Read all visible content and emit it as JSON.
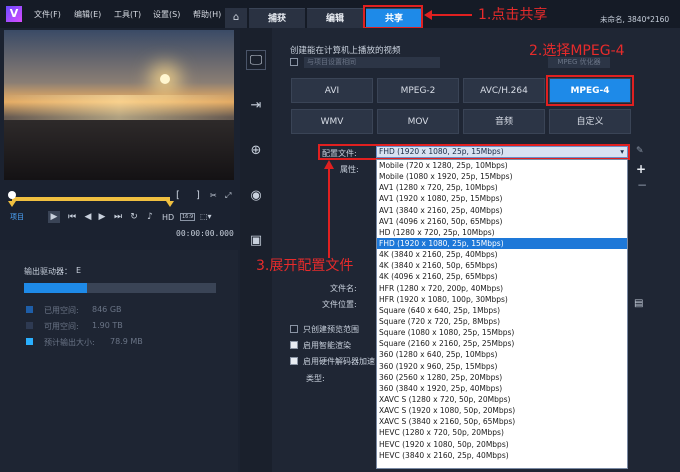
{
  "menu": {
    "file": "文件(F)",
    "edit": "编辑(E)",
    "tools": "工具(T)",
    "settings": "设置(S)",
    "help": "帮助(H)"
  },
  "tabs": {
    "capture": "捕获",
    "edit": "编辑",
    "share": "共享"
  },
  "project_info": "未命名, 3840*2160",
  "annotations": {
    "step1": "1.点击共享",
    "step2": "2.选择MPEG-4",
    "step3": "3.展开配置文件"
  },
  "player": {
    "project_label": "项目",
    "timecode": "00:00:00.000",
    "hd": "HD",
    "ratio": "16:9"
  },
  "output": {
    "drive_label": "输出驱动器：",
    "drive": "E",
    "used_label": "已用空间:",
    "used": "846 GB",
    "free_label": "可用空间:",
    "free": "1.90 TB",
    "estimated_label": "预计输出大小:",
    "estimated": "78.9 MB",
    "drive_fill_percent": 33
  },
  "share": {
    "heading": "创建能在计算机上播放的视频",
    "match_project": "与项目设置相同",
    "mpeg_optimizer": "MPEG 优化器",
    "formats": [
      "AVI",
      "MPEG-2",
      "AVC/H.264",
      "MPEG-4",
      "WMV",
      "MOV",
      "音频",
      "自定义"
    ],
    "selected_format": "MPEG-4",
    "profile_label": "配置文件:",
    "profile_value": "FHD (1920 x 1080, 25p, 15Mbps)",
    "properties_label": "属性:",
    "filename_label": "文件名:",
    "location_label": "文件位置:",
    "preview_only": "只创建预览范围",
    "smart_render": "启用智能渲染",
    "hw_encoder": "启用硬件解码器加速",
    "type_label": "类型:"
  },
  "profiles": [
    "Mobile (720 x 1280, 25p, 10Mbps)",
    "Mobile (1080 x 1920, 25p, 15Mbps)",
    "AV1 (1280 x 720, 25p, 10Mbps)",
    "AV1 (1920 x 1080, 25p, 15Mbps)",
    "AV1 (3840 x 2160, 25p, 40Mbps)",
    "AV1 (4096 x 2160, 50p, 65Mbps)",
    "HD (1280 x 720, 25p, 10Mbps)",
    "FHD (1920 x 1080, 25p, 15Mbps)",
    "4K (3840 x 2160, 25p, 40Mbps)",
    "4K (3840 x 2160, 50p, 65Mbps)",
    "4K (4096 x 2160, 25p, 65Mbps)",
    "HFR (1280 x 720, 200p, 40Mbps)",
    "HFR (1920 x 1080, 100p, 30Mbps)",
    "Square (640 x 640, 25p, 1Mbps)",
    "Square (720 x 720, 25p, 8Mbps)",
    "Square (1080 x 1080, 25p, 15Mbps)",
    "Square (2160 x 2160, 25p, 25Mbps)",
    "360 (1280 x 640, 25p, 10Mbps)",
    "360 (1920 x 960, 25p, 15Mbps)",
    "360 (2560 x 1280, 25p, 20Mbps)",
    "360 (3840 x 1920, 25p, 40Mbps)",
    "XAVC S (1280 x 720, 50p, 20Mbps)",
    "XAVC S (1920 x 1080, 50p, 20Mbps)",
    "XAVC S (3840 x 2160, 50p, 65Mbps)",
    "HEVC (1280 x 720, 50p, 20Mbps)",
    "HEVC (1920 x 1080, 50p, 20Mbps)",
    "HEVC (3840 x 2160, 25p, 40Mbps)"
  ],
  "selected_profile_index": 7,
  "colors": {
    "accent": "#1e8ae8",
    "annotation": "#e02020"
  }
}
